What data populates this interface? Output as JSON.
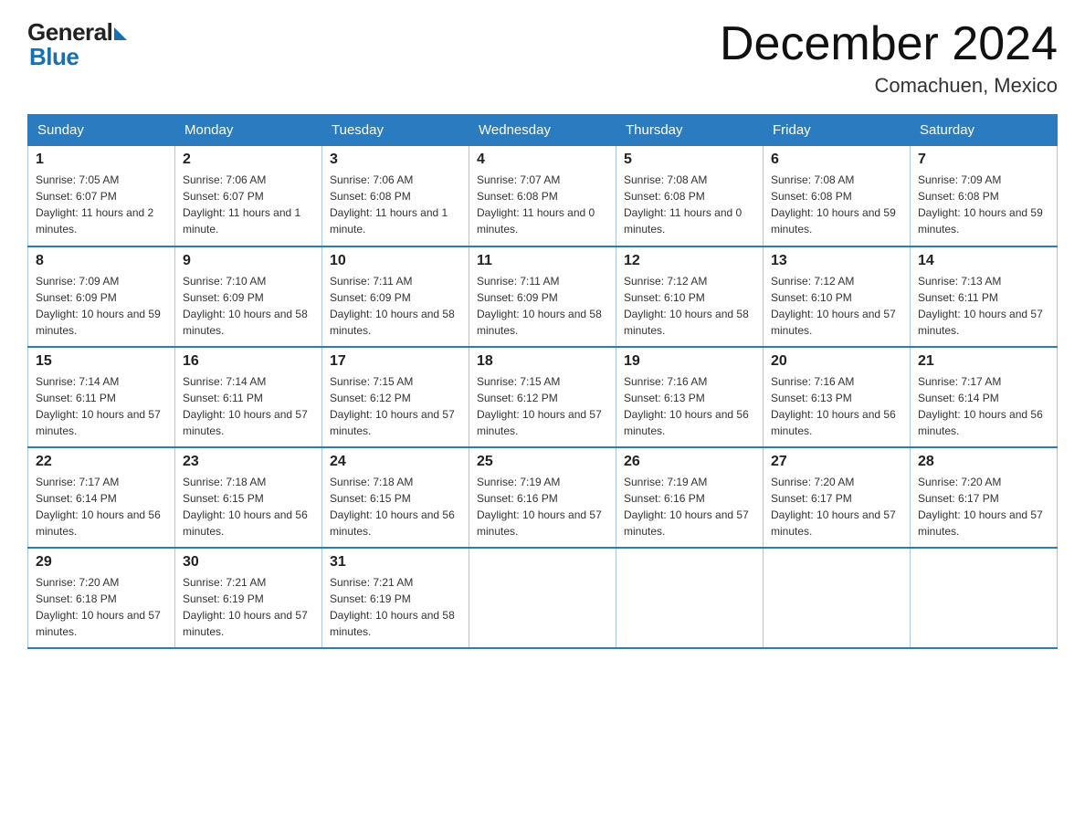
{
  "header": {
    "logo_general": "General",
    "logo_blue": "Blue",
    "month_title": "December 2024",
    "location": "Comachuen, Mexico"
  },
  "days_of_week": [
    "Sunday",
    "Monday",
    "Tuesday",
    "Wednesday",
    "Thursday",
    "Friday",
    "Saturday"
  ],
  "weeks": [
    [
      {
        "num": "1",
        "sunrise": "7:05 AM",
        "sunset": "6:07 PM",
        "daylight": "11 hours and 2 minutes."
      },
      {
        "num": "2",
        "sunrise": "7:06 AM",
        "sunset": "6:07 PM",
        "daylight": "11 hours and 1 minute."
      },
      {
        "num": "3",
        "sunrise": "7:06 AM",
        "sunset": "6:08 PM",
        "daylight": "11 hours and 1 minute."
      },
      {
        "num": "4",
        "sunrise": "7:07 AM",
        "sunset": "6:08 PM",
        "daylight": "11 hours and 0 minutes."
      },
      {
        "num": "5",
        "sunrise": "7:08 AM",
        "sunset": "6:08 PM",
        "daylight": "11 hours and 0 minutes."
      },
      {
        "num": "6",
        "sunrise": "7:08 AM",
        "sunset": "6:08 PM",
        "daylight": "10 hours and 59 minutes."
      },
      {
        "num": "7",
        "sunrise": "7:09 AM",
        "sunset": "6:08 PM",
        "daylight": "10 hours and 59 minutes."
      }
    ],
    [
      {
        "num": "8",
        "sunrise": "7:09 AM",
        "sunset": "6:09 PM",
        "daylight": "10 hours and 59 minutes."
      },
      {
        "num": "9",
        "sunrise": "7:10 AM",
        "sunset": "6:09 PM",
        "daylight": "10 hours and 58 minutes."
      },
      {
        "num": "10",
        "sunrise": "7:11 AM",
        "sunset": "6:09 PM",
        "daylight": "10 hours and 58 minutes."
      },
      {
        "num": "11",
        "sunrise": "7:11 AM",
        "sunset": "6:09 PM",
        "daylight": "10 hours and 58 minutes."
      },
      {
        "num": "12",
        "sunrise": "7:12 AM",
        "sunset": "6:10 PM",
        "daylight": "10 hours and 58 minutes."
      },
      {
        "num": "13",
        "sunrise": "7:12 AM",
        "sunset": "6:10 PM",
        "daylight": "10 hours and 57 minutes."
      },
      {
        "num": "14",
        "sunrise": "7:13 AM",
        "sunset": "6:11 PM",
        "daylight": "10 hours and 57 minutes."
      }
    ],
    [
      {
        "num": "15",
        "sunrise": "7:14 AM",
        "sunset": "6:11 PM",
        "daylight": "10 hours and 57 minutes."
      },
      {
        "num": "16",
        "sunrise": "7:14 AM",
        "sunset": "6:11 PM",
        "daylight": "10 hours and 57 minutes."
      },
      {
        "num": "17",
        "sunrise": "7:15 AM",
        "sunset": "6:12 PM",
        "daylight": "10 hours and 57 minutes."
      },
      {
        "num": "18",
        "sunrise": "7:15 AM",
        "sunset": "6:12 PM",
        "daylight": "10 hours and 57 minutes."
      },
      {
        "num": "19",
        "sunrise": "7:16 AM",
        "sunset": "6:13 PM",
        "daylight": "10 hours and 56 minutes."
      },
      {
        "num": "20",
        "sunrise": "7:16 AM",
        "sunset": "6:13 PM",
        "daylight": "10 hours and 56 minutes."
      },
      {
        "num": "21",
        "sunrise": "7:17 AM",
        "sunset": "6:14 PM",
        "daylight": "10 hours and 56 minutes."
      }
    ],
    [
      {
        "num": "22",
        "sunrise": "7:17 AM",
        "sunset": "6:14 PM",
        "daylight": "10 hours and 56 minutes."
      },
      {
        "num": "23",
        "sunrise": "7:18 AM",
        "sunset": "6:15 PM",
        "daylight": "10 hours and 56 minutes."
      },
      {
        "num": "24",
        "sunrise": "7:18 AM",
        "sunset": "6:15 PM",
        "daylight": "10 hours and 56 minutes."
      },
      {
        "num": "25",
        "sunrise": "7:19 AM",
        "sunset": "6:16 PM",
        "daylight": "10 hours and 57 minutes."
      },
      {
        "num": "26",
        "sunrise": "7:19 AM",
        "sunset": "6:16 PM",
        "daylight": "10 hours and 57 minutes."
      },
      {
        "num": "27",
        "sunrise": "7:20 AM",
        "sunset": "6:17 PM",
        "daylight": "10 hours and 57 minutes."
      },
      {
        "num": "28",
        "sunrise": "7:20 AM",
        "sunset": "6:17 PM",
        "daylight": "10 hours and 57 minutes."
      }
    ],
    [
      {
        "num": "29",
        "sunrise": "7:20 AM",
        "sunset": "6:18 PM",
        "daylight": "10 hours and 57 minutes."
      },
      {
        "num": "30",
        "sunrise": "7:21 AM",
        "sunset": "6:19 PM",
        "daylight": "10 hours and 57 minutes."
      },
      {
        "num": "31",
        "sunrise": "7:21 AM",
        "sunset": "6:19 PM",
        "daylight": "10 hours and 58 minutes."
      },
      null,
      null,
      null,
      null
    ]
  ]
}
